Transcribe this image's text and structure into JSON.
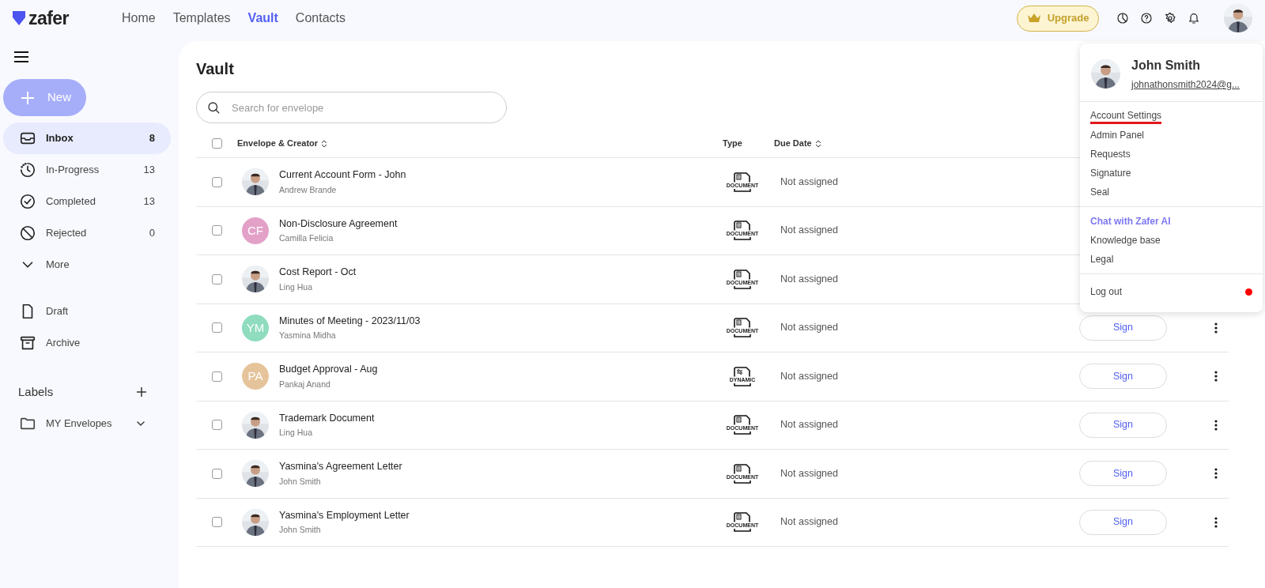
{
  "brand": "zafer",
  "nav": [
    {
      "label": "Home",
      "selected": false
    },
    {
      "label": "Templates",
      "selected": false
    },
    {
      "label": "Vault",
      "selected": true
    },
    {
      "label": "Contacts",
      "selected": false
    }
  ],
  "upgrade": "Upgrade",
  "new_button": "New",
  "sidebar": {
    "items": [
      {
        "label": "Inbox",
        "count": "8",
        "selected": true
      },
      {
        "label": "In-Progress",
        "count": "13",
        "selected": false
      },
      {
        "label": "Completed",
        "count": "13",
        "selected": false
      },
      {
        "label": "Rejected",
        "count": "0",
        "selected": false
      },
      {
        "label": "More",
        "selected": false
      }
    ],
    "items2": [
      {
        "label": "Draft",
        "selected": false
      },
      {
        "label": "Archive",
        "selected": false
      }
    ],
    "labels_title": "Labels",
    "labels": [
      {
        "label": "MY Envelopes",
        "expanded": false
      }
    ]
  },
  "page_title": "Vault",
  "search": {
    "placeholder": "Search for envelope"
  },
  "table": {
    "select_all": {
      "checked": false
    },
    "columns": [
      "Envelope & Creator",
      "Type",
      "Due Date"
    ],
    "rows": [
      {
        "title": "Current Account Form - John",
        "creator": "Andrew Brande",
        "type": "DOCUMENT",
        "kind": "document",
        "due": "Not assigned",
        "checked": false
      },
      {
        "title": "Non-Disclosure Agreement",
        "creator": "Camilla Felicia",
        "avatar": {
          "kind": "initials",
          "initials": "CF",
          "color": "#e3a1c8"
        },
        "type": "DOCUMENT",
        "kind": "document",
        "due": "Not assigned",
        "checked": false
      },
      {
        "title": "Cost Report - Oct",
        "creator": "Ling Hua",
        "type": "DOCUMENT",
        "kind": "document",
        "due": "Not assigned",
        "checked": false
      },
      {
        "title": "Minutes of Meeting - 2023/11/03",
        "creator": "Yasmina Midha",
        "avatar": {
          "kind": "initials",
          "initials": "YM",
          "color": "#8fdcbf"
        },
        "type": "DOCUMENT",
        "kind": "document",
        "due": "Not assigned",
        "checked": false,
        "action": "Sign"
      },
      {
        "title": "Budget Approval - Aug",
        "creator": "Pankaj Anand",
        "avatar": {
          "kind": "initials",
          "initials": "PA",
          "color": "#e6c49b"
        },
        "type": "DYNAMIC",
        "kind": "dynamic",
        "due": "Not assigned",
        "checked": false,
        "action": "Sign"
      },
      {
        "title": "Trademark Document",
        "creator": "Ling Hua",
        "type": "DOCUMENT",
        "kind": "document",
        "due": "Not assigned",
        "checked": false,
        "action": "Sign"
      },
      {
        "title": "Yasmina's Agreement Letter",
        "creator": "John Smith",
        "type": "DOCUMENT",
        "kind": "document",
        "due": "Not assigned",
        "checked": false,
        "action": "Sign"
      },
      {
        "title": "Yasmina's Employment Letter",
        "creator": "John Smith",
        "type": "DOCUMENT",
        "kind": "document",
        "due": "Not assigned",
        "checked": false,
        "action": "Sign"
      }
    ]
  },
  "user_menu": {
    "name": "John Smith",
    "email": "johnathonsmith2024@g...",
    "groups": [
      [
        {
          "label": "Account Settings",
          "kind": "underlined"
        },
        {
          "label": "Admin Panel",
          "kind": "plain"
        },
        {
          "label": "Requests",
          "kind": "plain"
        },
        {
          "label": "Signature",
          "kind": "plain"
        },
        {
          "label": "Seal",
          "kind": "plain"
        }
      ],
      [
        {
          "label": "Chat with Zafer AI",
          "kind": "accent"
        },
        {
          "label": "Knowledge base",
          "kind": "plain"
        },
        {
          "label": "Legal",
          "kind": "plain"
        }
      ],
      [
        {
          "label": "Log out",
          "kind": "dot"
        }
      ]
    ]
  }
}
